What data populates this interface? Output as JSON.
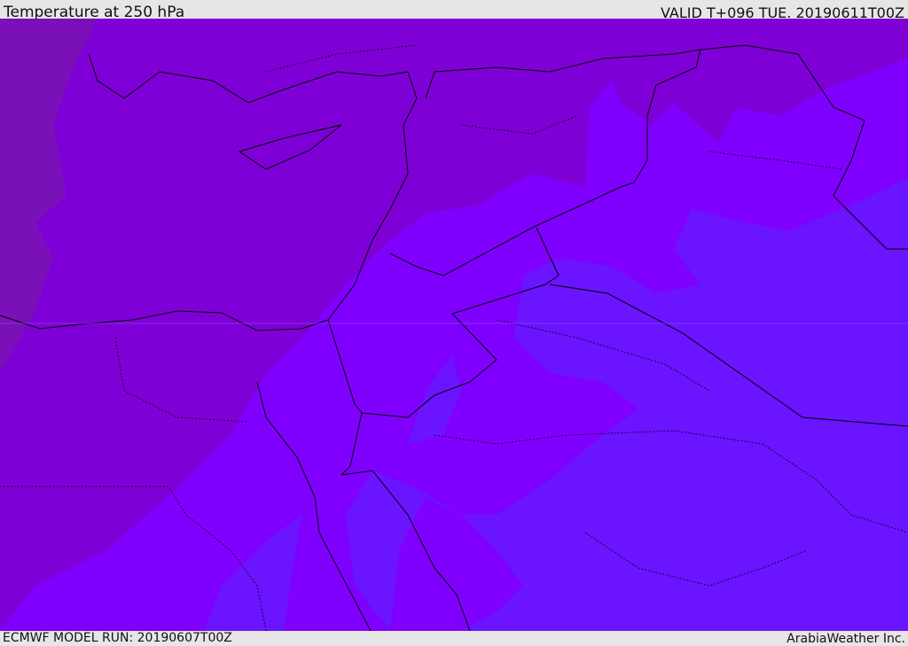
{
  "header": {
    "title": "Temperature at 250 hPa",
    "valid": "VALID T+096 TUE. 20190611T00Z"
  },
  "footer": {
    "model_run": "ECMWF MODEL RUN: 20190607T00Z",
    "credit": "ArabiaWeather Inc."
  },
  "colors": {
    "coldest": "#7a10b8",
    "cold": "#7f00d6",
    "mid": "#8000ff",
    "warm": "#6a14ff",
    "border": "#000000"
  }
}
